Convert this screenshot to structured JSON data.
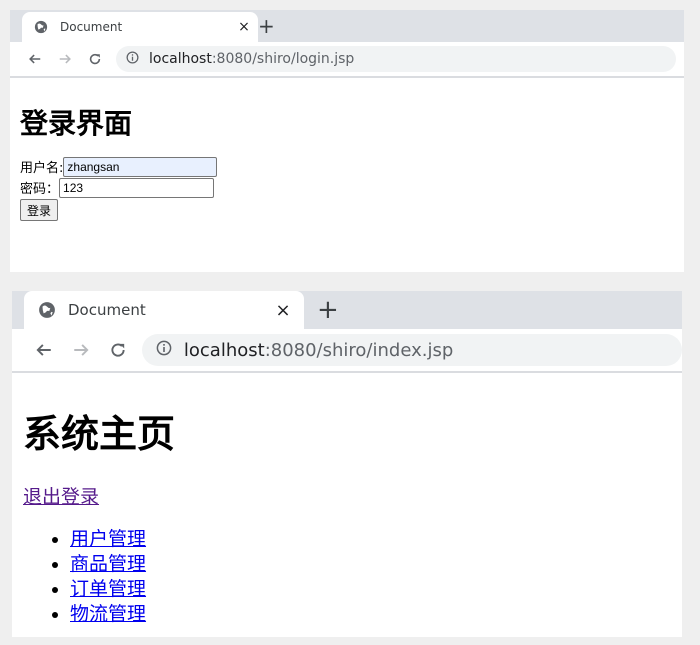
{
  "login_window": {
    "tab": {
      "title": "Document",
      "close": "×",
      "new_tab": "+"
    },
    "address": {
      "host": "localhost",
      "path": ":8080/shiro/login.jsp"
    },
    "page": {
      "heading": "登录界面",
      "username_label": "用户名:",
      "username_value": "zhangsan",
      "password_label": "密码：",
      "password_value": "123",
      "submit_label": "登录"
    }
  },
  "home_window": {
    "tab": {
      "title": "Document",
      "close": "×",
      "new_tab": "+"
    },
    "address": {
      "host": "localhost",
      "path": ":8080/shiro/index.jsp"
    },
    "page": {
      "heading": "系统主页",
      "logout_link": "退出登录",
      "menu": [
        "用户管理",
        "商品管理",
        "订单管理",
        "物流管理"
      ]
    }
  }
}
